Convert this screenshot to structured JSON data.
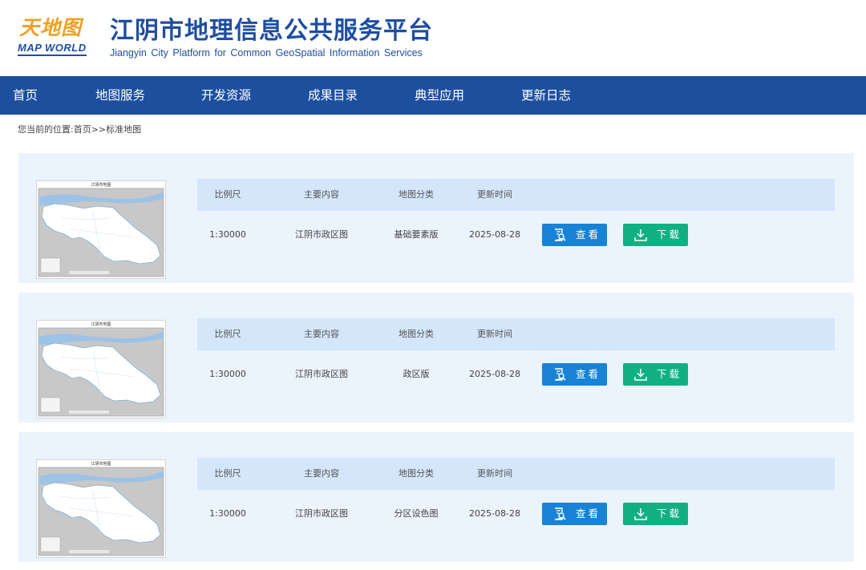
{
  "header": {
    "logo_cn": "天地图",
    "logo_en": "MAP WORLD",
    "title": "江阴市地理信息公共服务平台",
    "subtitle": "Jiangyin City Platform for Common GeoSpatial Information Services"
  },
  "nav": {
    "items": [
      {
        "label": "首页"
      },
      {
        "label": "地图服务"
      },
      {
        "label": "开发资源"
      },
      {
        "label": "成果目录"
      },
      {
        "label": "典型应用"
      },
      {
        "label": "更新日志"
      }
    ]
  },
  "breadcrumb": {
    "prefix": "您当前的位置:",
    "home": "首页",
    "separator": ">>",
    "current": "标准地图"
  },
  "table_headers": {
    "scale": "比例尺",
    "content": "主要内容",
    "category": "地图分类",
    "updated": "更新时间"
  },
  "actions": {
    "view_label": "查看",
    "download_label": "下载"
  },
  "maps": [
    {
      "thumb_title": "江阴市地图",
      "scale": "1:30000",
      "content": "江阴市政区图",
      "category": "基础要素版",
      "updated": "2025-08-28"
    },
    {
      "thumb_title": "江阴市地图",
      "scale": "1:30000",
      "content": "江阴市政区图",
      "category": "政区版",
      "updated": "2025-08-28"
    },
    {
      "thumb_title": "江阴市地图",
      "scale": "1:30000",
      "content": "江阴市政区图",
      "category": "分区设色图",
      "updated": "2025-08-28"
    }
  ],
  "colors": {
    "brand_blue": "#1d4f9f",
    "view_button": "#1883d6",
    "download_button": "#11b083",
    "card_bg": "#ebf3fd",
    "header_row_bg": "#d4e6fa",
    "logo_orange": "#f0a020"
  }
}
